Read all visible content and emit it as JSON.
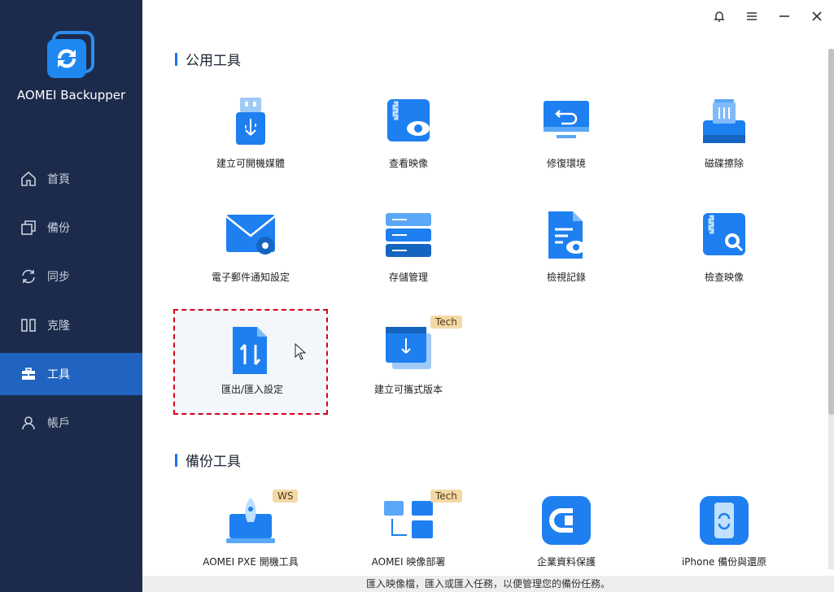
{
  "app": {
    "name": "AOMEI Backupper"
  },
  "sidebar": {
    "items": [
      {
        "label": "首頁",
        "icon": "home-icon"
      },
      {
        "label": "備份",
        "icon": "backup-icon"
      },
      {
        "label": "同步",
        "icon": "sync-icon"
      },
      {
        "label": "克隆",
        "icon": "clone-icon"
      },
      {
        "label": "工具",
        "icon": "toolbox-icon",
        "active": true
      },
      {
        "label": "帳戶",
        "icon": "user-icon"
      }
    ]
  },
  "sections": {
    "common": {
      "title": "公用工具",
      "tools": [
        {
          "label": "建立可開機媒體",
          "icon": "usb-drive-icon"
        },
        {
          "label": "查看映像",
          "icon": "view-image-icon"
        },
        {
          "label": "修復環境",
          "icon": "monitor-restore-icon"
        },
        {
          "label": "磁碟擦除",
          "icon": "disk-wipe-icon"
        },
        {
          "label": "電子郵件通知設定",
          "icon": "email-settings-icon"
        },
        {
          "label": "存儲管理",
          "icon": "storage-icon"
        },
        {
          "label": "檢視記錄",
          "icon": "log-view-icon"
        },
        {
          "label": "檢查映像",
          "icon": "check-image-icon"
        },
        {
          "label": "匯出/匯入設定",
          "icon": "export-import-icon",
          "selected": true
        },
        {
          "label": "建立可攜式版本",
          "icon": "portable-version-icon",
          "badge": "Tech"
        }
      ]
    },
    "backup": {
      "title": "備份工具",
      "tools": [
        {
          "label": "AOMEI PXE 開機工具",
          "icon": "pxe-boot-icon",
          "badge": "WS"
        },
        {
          "label": "AOMEI 映像部署",
          "icon": "image-deploy-icon",
          "badge": "Tech"
        },
        {
          "label": "企業資料保護",
          "icon": "centralized-backup-icon"
        },
        {
          "label": "iPhone 備份與還原",
          "icon": "iphone-backup-icon"
        }
      ]
    }
  },
  "status": {
    "text": "匯入映像檔，匯入或匯入任務，以便管理您的備份任務。"
  },
  "colors": {
    "sidebar": "#1c2b4b",
    "accent": "#2163c0",
    "selection": "#d9001b"
  }
}
